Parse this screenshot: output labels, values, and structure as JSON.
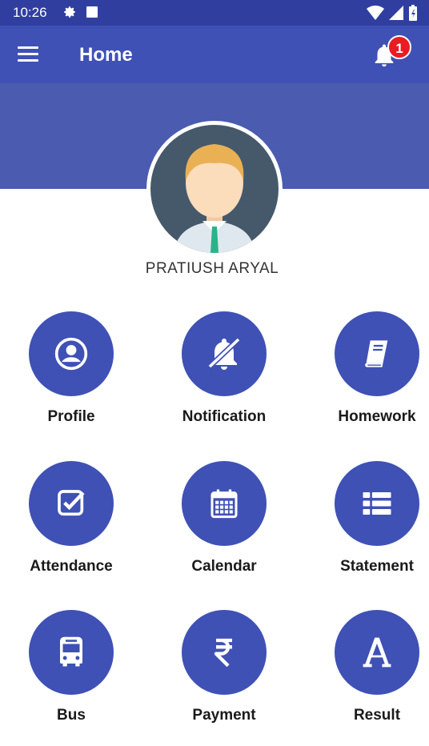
{
  "status_bar": {
    "time": "10:26"
  },
  "app_bar": {
    "title": "Home",
    "notification_count": "1"
  },
  "profile": {
    "name": "PRATIUSH ARYAL"
  },
  "colors": {
    "primary": "#3f51b5",
    "status_bar": "#303f9f",
    "banner": "#4a5bb0",
    "badge": "#e81c23"
  },
  "menu": [
    {
      "label": "Profile",
      "icon": "person-circle-icon"
    },
    {
      "label": "Notification",
      "icon": "bell-off-icon"
    },
    {
      "label": "Homework",
      "icon": "book-icon"
    },
    {
      "label": "Attendance",
      "icon": "checkbox-icon"
    },
    {
      "label": "Calendar",
      "icon": "calendar-icon"
    },
    {
      "label": "Statement",
      "icon": "list-icon"
    },
    {
      "label": "Bus",
      "icon": "bus-icon"
    },
    {
      "label": "Payment",
      "icon": "rupee-icon"
    },
    {
      "label": "Result",
      "icon": "letter-a-icon"
    }
  ]
}
